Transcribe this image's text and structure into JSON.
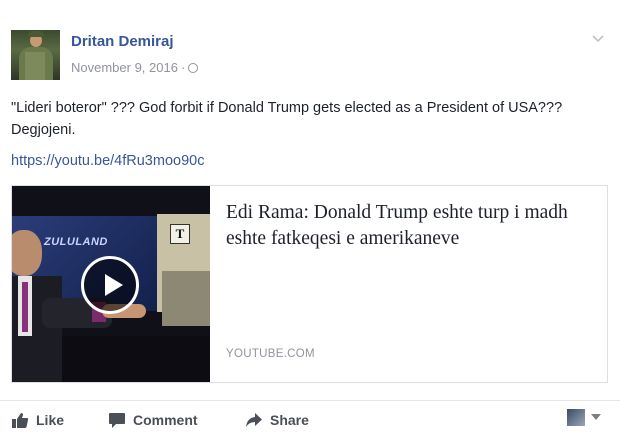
{
  "post": {
    "author": "Dritan Demiraj",
    "date": "November 9, 2016",
    "separator": "·",
    "privacy_icon": "globe-icon",
    "message": "\"Lideri boteror\" ??? God forbit if Donald Trump gets elected as a President of USA??? Degjojeni.",
    "link": "https://youtu.be/4fRu3moo90c"
  },
  "card": {
    "title": "Edi Rama: Donald Trump eshte turp i madh eshte fatkeqesi e amerikaneve",
    "domain": "YOUTUBE.COM",
    "thumbnail_text": "ZULULAND",
    "thumbnail_badge": "T",
    "play_icon": "play-icon"
  },
  "actions": {
    "like": "Like",
    "comment": "Comment",
    "share": "Share"
  },
  "colors": {
    "name_link": "#365899",
    "meta_gray": "#90949c",
    "action_gray": "#4b4f56",
    "border": "#dddfe2"
  }
}
